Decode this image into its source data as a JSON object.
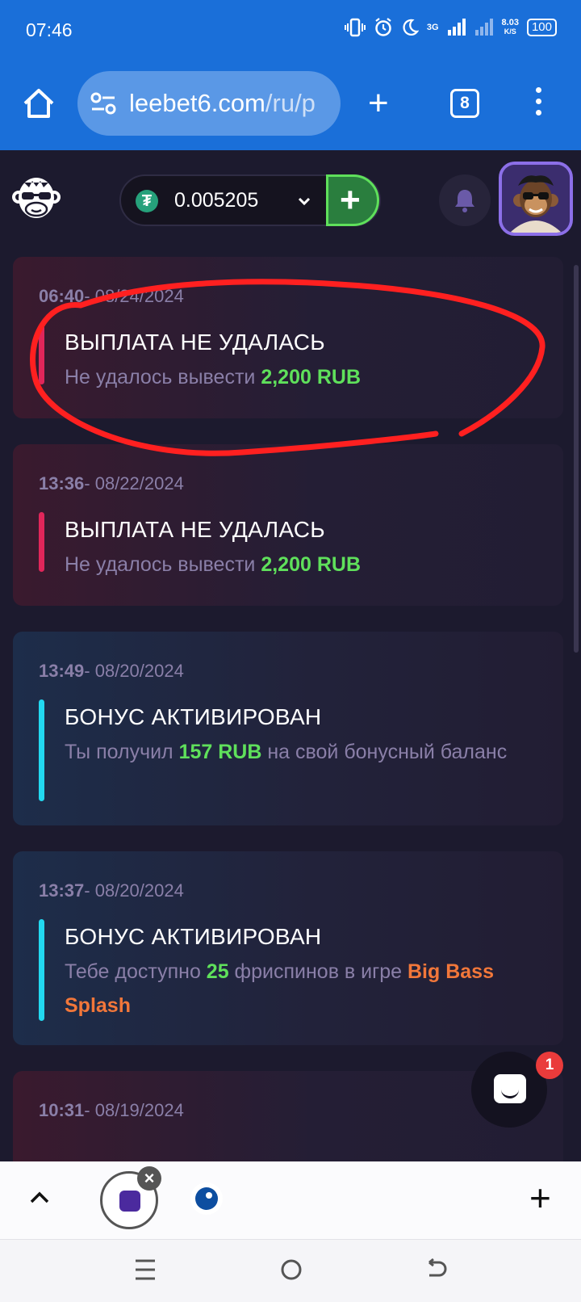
{
  "status_bar": {
    "time": "07:46",
    "net_type": "3G",
    "speed_value": "8.03",
    "speed_unit": "K/S",
    "battery": "100"
  },
  "browser": {
    "url_host": "leebet6.com",
    "url_path": "/ru/p",
    "tab_count": "8"
  },
  "header": {
    "balance": "0.005205",
    "currency_icon": "usdt-icon",
    "deposit_symbol": "+",
    "accent_green": "#5fe05b"
  },
  "notifications": [
    {
      "time": "06:40",
      "date": "- 08/24/2024",
      "title": "ВЫПЛАТА НЕ УДАЛАСЬ",
      "msg_pre": "Не удалось вывести ",
      "msg_amount": "2,200 RUB",
      "msg_post": "",
      "accent": "#e0265a"
    },
    {
      "time": "13:36",
      "date": "- 08/22/2024",
      "title": "ВЫПЛАТА НЕ УДАЛАСЬ",
      "msg_pre": "Не удалось вывести ",
      "msg_amount": "2,200 RUB",
      "msg_post": "",
      "accent": "#e0265a"
    },
    {
      "time": "13:49",
      "date": "- 08/20/2024",
      "title": "БОНУС АКТИВИРОВАН",
      "msg_pre": "Ты получил ",
      "msg_amount": "157 RUB",
      "msg_post": " на свой бонусный баланс",
      "accent": "#22d8f0"
    },
    {
      "time": "13:37",
      "date": "- 08/20/2024",
      "title": "БОНУС АКТИВИРОВАН",
      "msg_pre": "Тебе доступно ",
      "msg_amount": "25",
      "msg_post": " фриспинов в игре ",
      "msg_game": "Big Bass Splash",
      "accent": "#22d8f0"
    },
    {
      "time": "10:31",
      "date": "- 08/19/2024"
    }
  ],
  "chat": {
    "unread": "1"
  },
  "bottom_tabs": {
    "new_tab_symbol": "+"
  },
  "annotation": {
    "color": "#ff2020"
  }
}
